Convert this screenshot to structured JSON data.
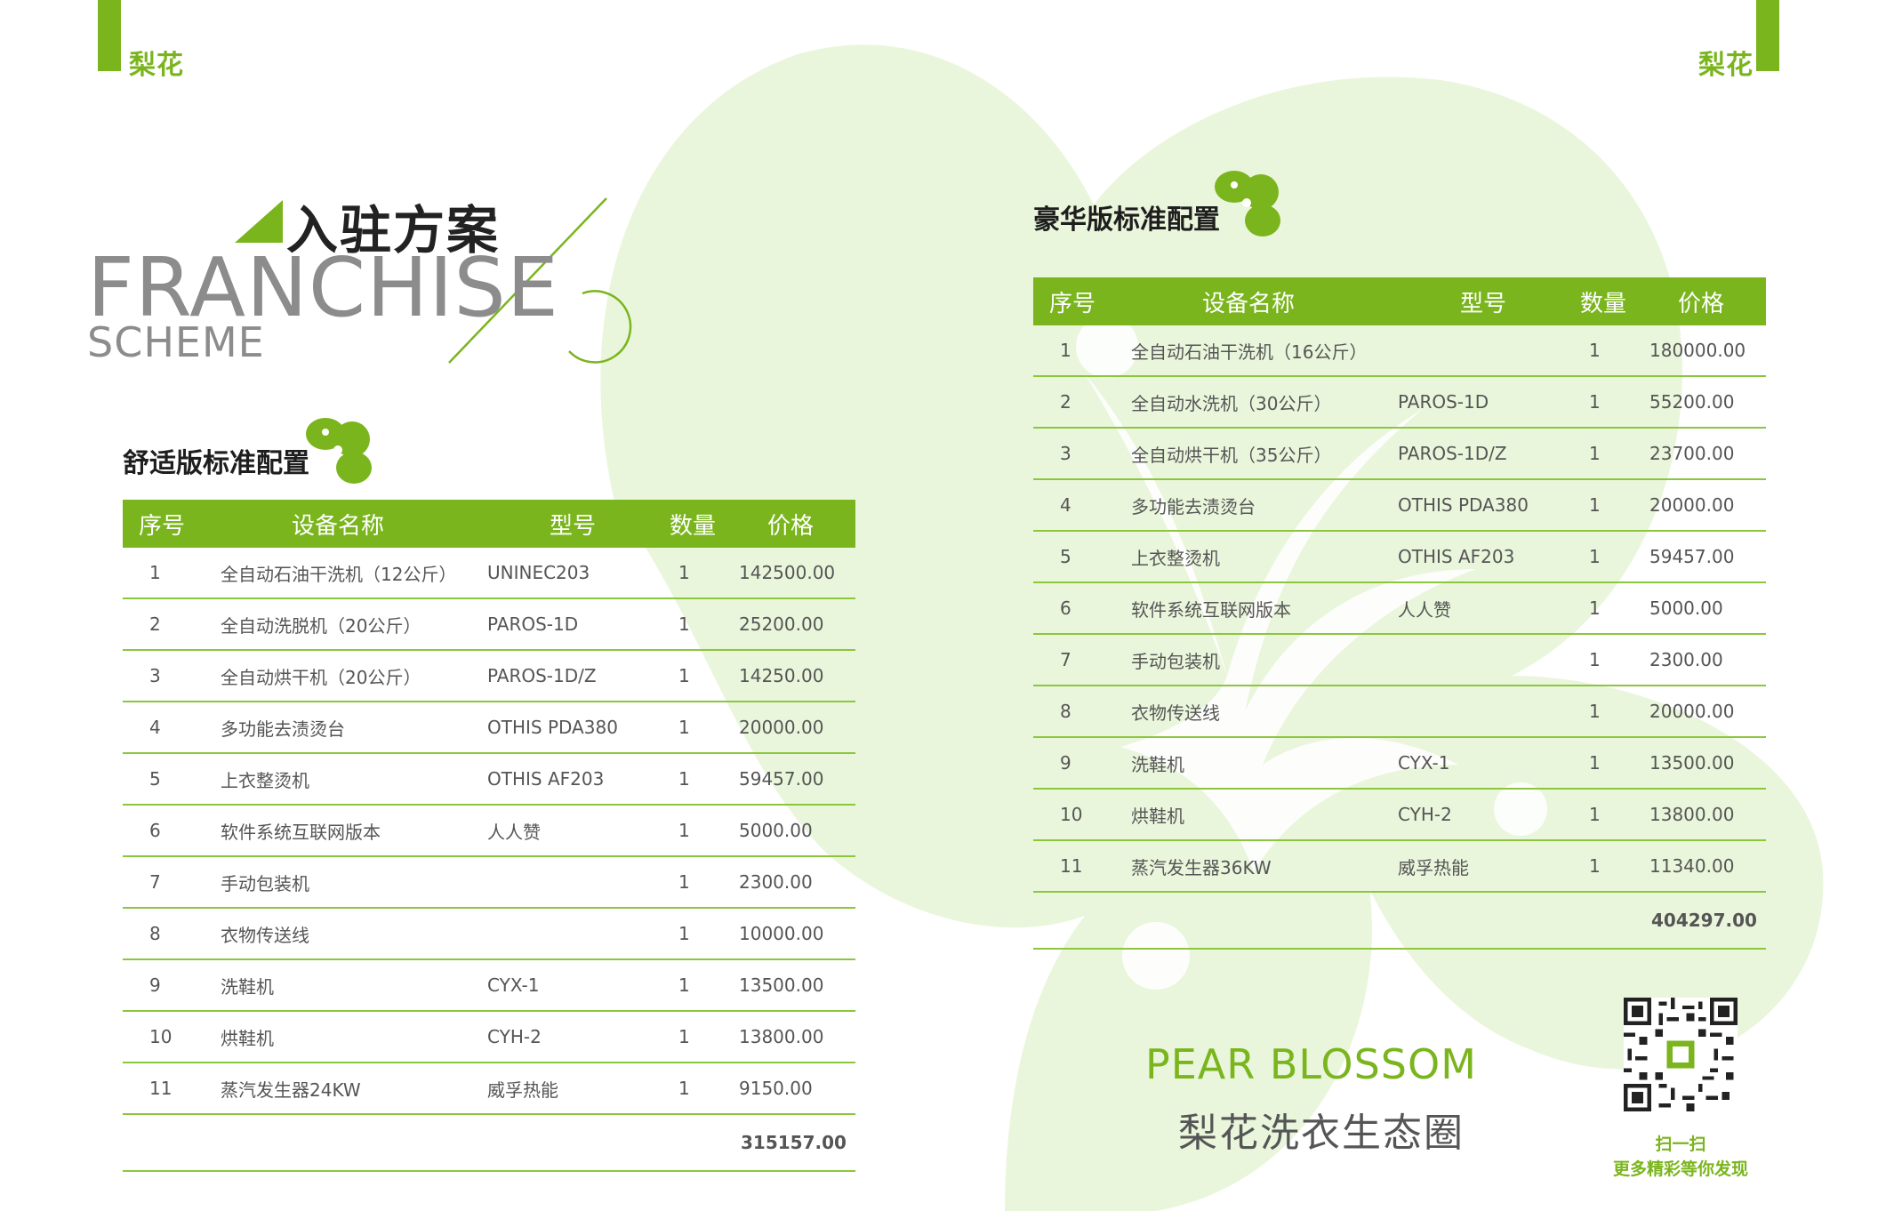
{
  "brand": {
    "logo_left": "梨花",
    "logo_right": "梨花"
  },
  "colors": {
    "accent": "#7ab51d",
    "accent_light": "#eaf6dc",
    "heading": "#1e1e1e",
    "en_title": "#8c8c8c"
  },
  "header": {
    "title_cn": "入驻方案",
    "title_en_line1": "FRANCHISE",
    "title_en_line2": "SCHEME"
  },
  "comfort": {
    "title": "舒适版标准配置",
    "columns": [
      "序号",
      "设备名称",
      "型号",
      "数量",
      "价格"
    ],
    "rows": [
      [
        "1",
        "全自动石油干洗机（12公斤）",
        "UNINEC203",
        "1",
        "142500.00"
      ],
      [
        "2",
        "全自动洗脱机（20公斤）",
        "PAROS-1D",
        "1",
        "25200.00"
      ],
      [
        "3",
        "全自动烘干机（20公斤）",
        "PAROS-1D/Z",
        "1",
        "14250.00"
      ],
      [
        "4",
        "多功能去渍烫台",
        "OTHIS PDA380",
        "1",
        "20000.00"
      ],
      [
        "5",
        "上衣整烫机",
        "OTHIS AF203",
        "1",
        "59457.00"
      ],
      [
        "6",
        "软件系统互联网版本",
        "人人赞",
        "1",
        "5000.00"
      ],
      [
        "7",
        "手动包装机",
        "",
        "1",
        "2300.00"
      ],
      [
        "8",
        "衣物传送线",
        "",
        "1",
        "10000.00"
      ],
      [
        "9",
        "洗鞋机",
        "CYX-1",
        "1",
        "13500.00"
      ],
      [
        "10",
        "烘鞋机",
        "CYH-2",
        "1",
        "13800.00"
      ],
      [
        "11",
        "蒸汽发生器24KW",
        "威孚热能",
        "1",
        "9150.00"
      ]
    ],
    "total": "315157.00"
  },
  "luxury": {
    "title": "豪华版标准配置",
    "columns": [
      "序号",
      "设备名称",
      "型号",
      "数量",
      "价格"
    ],
    "rows": [
      [
        "1",
        "全自动石油干洗机（16公斤）",
        "",
        "1",
        "180000.00"
      ],
      [
        "2",
        "全自动水洗机（30公斤）",
        "PAROS-1D",
        "1",
        "55200.00"
      ],
      [
        "3",
        "全自动烘干机（35公斤）",
        "PAROS-1D/Z",
        "1",
        "23700.00"
      ],
      [
        "4",
        "多功能去渍烫台",
        "OTHIS PDA380",
        "1",
        "20000.00"
      ],
      [
        "5",
        "上衣整烫机",
        "OTHIS AF203",
        "1",
        "59457.00"
      ],
      [
        "6",
        "软件系统互联网版本",
        "人人赞",
        "1",
        "5000.00"
      ],
      [
        "7",
        "手动包装机",
        "",
        "1",
        "2300.00"
      ],
      [
        "8",
        "衣物传送线",
        "",
        "1",
        "20000.00"
      ],
      [
        "9",
        "洗鞋机",
        "CYX-1",
        "1",
        "13500.00"
      ],
      [
        "10",
        "烘鞋机",
        "CYH-2",
        "1",
        "13800.00"
      ],
      [
        "11",
        "蒸汽发生器36KW",
        "威孚热能",
        "1",
        "11340.00"
      ]
    ],
    "total": "404297.00"
  },
  "footer": {
    "brand_en": "PEAR BLOSSOM",
    "brand_cn": "梨花洗衣生态圈",
    "qr_caption1": "扫一扫",
    "qr_caption2": "更多精彩等你发现",
    "qr_icon": "qr-code-icon"
  }
}
